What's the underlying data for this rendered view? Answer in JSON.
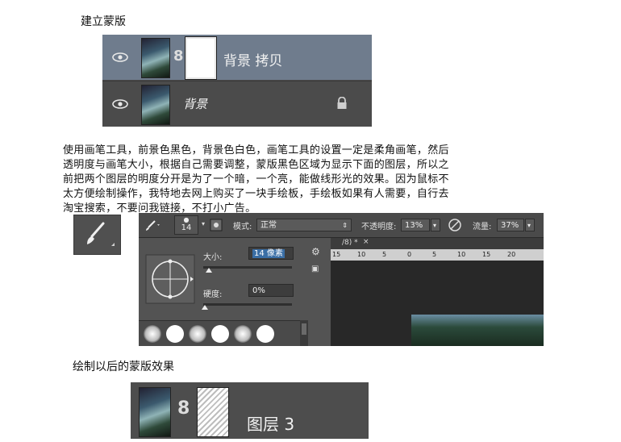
{
  "heading_create_mask": "建立蒙版",
  "layers_panel_1": {
    "layer_copy_name": "背景 拷贝",
    "layer_bg_name": "背景",
    "chain_glyph": "8"
  },
  "paragraph_lines": [
    "使用画笔工具，前景色黑色，背景色白色，画笔工具的设置一定是柔角画笔，然后",
    "透明度与画笔大小，根据自己需要调整，蒙版黑色区域为显示下面的图层，所以之",
    "前把两个图层的明度分开是为了一个暗，一个亮，能做线形光的效果。因为鼠标不",
    "太方便绘制操作，我特地去网上购买了一块手绘板，手绘板如果有人需要，自行去",
    "淘宝搜索，不要问我链接，不打小广告。"
  ],
  "options_bar": {
    "brush_size_value": "14",
    "mode_label": "模式:",
    "mode_value": "正常",
    "opacity_label": "不透明度:",
    "opacity_value": "13%",
    "flow_label": "流量:",
    "flow_value": "37%"
  },
  "brush_popup": {
    "size_label": "大小:",
    "size_value": "14 像素",
    "hardness_label": "硬度:",
    "hardness_value": "0%"
  },
  "document_tab": {
    "tab_text": "/8) *",
    "close_glyph": "×",
    "ruler_ticks": [
      "15",
      "10",
      "5",
      "0",
      "5",
      "10",
      "15",
      "20"
    ]
  },
  "heading_after": "绘制以后的蒙版效果",
  "layers_panel_2": {
    "layer_name": "图层 3",
    "chain_glyph": "8"
  },
  "colors": {
    "panel_dark": "#4a4a4a",
    "selected_row": "#6f7c8d",
    "selection_blue": "#3a6ea5"
  }
}
